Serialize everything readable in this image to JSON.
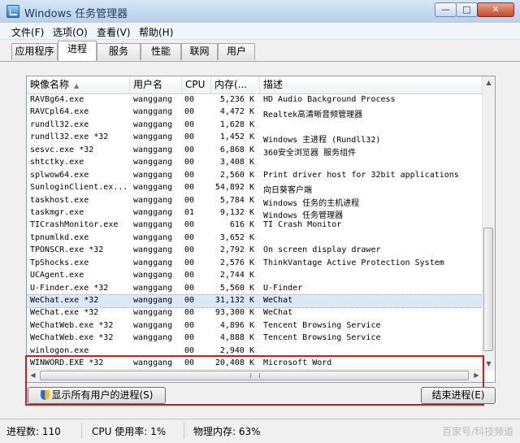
{
  "window": {
    "title": "Windows 任务管理器",
    "controls": {
      "minimize": "—",
      "maximize": "□",
      "close": "✕"
    }
  },
  "menu": [
    "文件(F)",
    "选项(O)",
    "查看(V)",
    "帮助(H)"
  ],
  "tabs": [
    {
      "label": "应用程序",
      "active": false
    },
    {
      "label": "进程",
      "active": true
    },
    {
      "label": "服务",
      "active": false
    },
    {
      "label": "性能",
      "active": false
    },
    {
      "label": "联网",
      "active": false
    },
    {
      "label": "用户",
      "active": false
    }
  ],
  "columns": {
    "name": "映像名称",
    "user": "用户名",
    "cpu": "CPU",
    "memory": "内存(...",
    "description": "描述"
  },
  "processes": [
    {
      "name": "RAVBg64.exe",
      "user": "wanggang",
      "cpu": "00",
      "memory": "5,236 K",
      "description": "HD Audio Background Process"
    },
    {
      "name": "RAVCpl64.exe",
      "user": "wanggang",
      "cpu": "00",
      "memory": "4,472 K",
      "description": "Realtek高清晰音频管理器"
    },
    {
      "name": "rundll32.exe",
      "user": "wanggang",
      "cpu": "00",
      "memory": "1,628 K",
      "description": ""
    },
    {
      "name": "rundll32.exe *32",
      "user": "wanggang",
      "cpu": "00",
      "memory": "1,452 K",
      "description": "Windows 主进程 (Rundll32)"
    },
    {
      "name": "sesvc.exe *32",
      "user": "wanggang",
      "cpu": "00",
      "memory": "6,868 K",
      "description": "360安全浏览器 服务组件"
    },
    {
      "name": "shtctky.exe",
      "user": "wanggang",
      "cpu": "00",
      "memory": "3,408 K",
      "description": ""
    },
    {
      "name": "splwow64.exe",
      "user": "wanggang",
      "cpu": "00",
      "memory": "2,560 K",
      "description": "Print driver host for 32bit applications"
    },
    {
      "name": "SunloginClient.ex...",
      "user": "wanggang",
      "cpu": "00",
      "memory": "54,892 K",
      "description": "向日葵客户端"
    },
    {
      "name": "taskhost.exe",
      "user": "wanggang",
      "cpu": "00",
      "memory": "5,784 K",
      "description": "Windows 任务的主机进程"
    },
    {
      "name": "taskmgr.exe",
      "user": "wanggang",
      "cpu": "01",
      "memory": "9,132 K",
      "description": "Windows 任务管理器"
    },
    {
      "name": "TICrashMonitor.exe",
      "user": "wanggang",
      "cpu": "00",
      "memory": "616 K",
      "description": "TI Crash Monitor"
    },
    {
      "name": "tpnumlkd.exe",
      "user": "wanggang",
      "cpu": "00",
      "memory": "3,652 K",
      "description": ""
    },
    {
      "name": "TPONSCR.exe *32",
      "user": "wanggang",
      "cpu": "00",
      "memory": "2,792 K",
      "description": "On screen display drawer"
    },
    {
      "name": "TpShocks.exe",
      "user": "wanggang",
      "cpu": "00",
      "memory": "2,576 K",
      "description": "ThinkVantage Active Protection System"
    },
    {
      "name": "UCAgent.exe",
      "user": "wanggang",
      "cpu": "00",
      "memory": "2,744 K",
      "description": ""
    },
    {
      "name": "U-Finder.exe *32",
      "user": "wanggang",
      "cpu": "00",
      "memory": "5,560 K",
      "description": "U-Finder"
    },
    {
      "name": "WeChat.exe *32",
      "user": "wanggang",
      "cpu": "00",
      "memory": "31,132 K",
      "description": "WeChat"
    },
    {
      "name": "WeChat.exe *32",
      "user": "wanggang",
      "cpu": "00",
      "memory": "93,300 K",
      "description": "WeChat"
    },
    {
      "name": "WeChatWeb.exe *32",
      "user": "wanggang",
      "cpu": "00",
      "memory": "4,896 K",
      "description": "Tencent Browsing Service"
    },
    {
      "name": "WeChatWeb.exe *32",
      "user": "wanggang",
      "cpu": "00",
      "memory": "4,888 K",
      "description": "Tencent Browsing Service"
    },
    {
      "name": "winlogon.exe",
      "user": "",
      "cpu": "00",
      "memory": "2,940 K",
      "description": ""
    },
    {
      "name": "WINWORD.EXE *32",
      "user": "wanggang",
      "cpu": "00",
      "memory": "20,408 K",
      "description": "Microsoft Word"
    }
  ],
  "selected_row": 16,
  "buttons": {
    "show_all": "显示所有用户的进程(S)",
    "end_process": "结束进程(E)"
  },
  "status": {
    "processes": "进程数: 110",
    "cpu": "CPU 使用率: 1%",
    "memory": "物理内存: 63%"
  },
  "watermark": "百家号/科技频道"
}
